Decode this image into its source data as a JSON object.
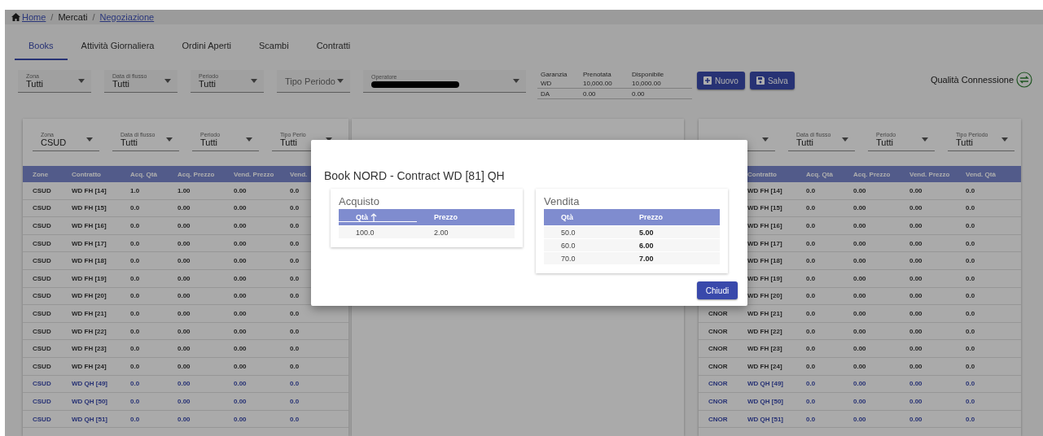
{
  "breadcrumb": {
    "separator": "/",
    "items": [
      {
        "label": "Home",
        "link": true
      },
      {
        "label": "Mercati",
        "link": false
      },
      {
        "label": "Negoziazione",
        "link": true
      }
    ]
  },
  "tabs": [
    {
      "label": "Books",
      "selected": true
    },
    {
      "label": "Attività Giornaliera",
      "selected": false
    },
    {
      "label": "Ordini Aperti",
      "selected": false
    },
    {
      "label": "Scambi",
      "selected": false
    },
    {
      "label": "Contratti",
      "selected": false
    }
  ],
  "filters": [
    {
      "kind": "select",
      "label": "Zona",
      "value": "Tutti"
    },
    {
      "kind": "select",
      "label": "Data di flusso",
      "value": "Tutti"
    },
    {
      "kind": "select",
      "label": "Periodo",
      "value": "Tutti"
    },
    {
      "kind": "placeholder",
      "placeholder": "Tipo Periodo"
    },
    {
      "kind": "redacted",
      "label": "Operatore"
    }
  ],
  "guarantee": {
    "columns": [
      "Garanzia",
      "Prenotata",
      "Disponibile"
    ],
    "rows": [
      [
        "WD",
        "10,000.00",
        "10,000.00"
      ],
      [
        "DA",
        "0.00",
        "0.00"
      ]
    ]
  },
  "buttons": [
    {
      "label": "Nuovo",
      "kind": "new"
    },
    {
      "label": "Salva",
      "kind": "save"
    }
  ],
  "connection": {
    "label": "Qualità Connessione"
  },
  "books": [
    {
      "filters": [
        {
          "kind": "full",
          "label": "Zona",
          "value": "CSUD"
        },
        {
          "kind": "full",
          "label": "Data di flusso",
          "value": "Tutti"
        },
        {
          "kind": "full",
          "label": "Periodo",
          "value": "Tutti"
        },
        {
          "kind": "full",
          "label": "Tipo Perio",
          "value": "Tutti"
        }
      ],
      "columns": [
        "Zone",
        "Contratto",
        "Acq. Qtà",
        "Acq. Prezzo",
        "Vend. Prezzo",
        "Vend."
      ],
      "rows": [
        {
          "highlighted": false,
          "cells": [
            "CSUD",
            "WD FH [14]",
            "1.0",
            "1.00",
            "0.00",
            "0.0"
          ]
        },
        {
          "highlighted": false,
          "cells": [
            "CSUD",
            "WD FH [15]",
            "0.0",
            "0.00",
            "0.00",
            "0.0"
          ]
        },
        {
          "highlighted": false,
          "cells": [
            "CSUD",
            "WD FH [16]",
            "0.0",
            "0.00",
            "0.00",
            "0.0"
          ]
        },
        {
          "highlighted": false,
          "cells": [
            "CSUD",
            "WD FH [17]",
            "0.0",
            "0.00",
            "0.00",
            "0.0"
          ]
        },
        {
          "highlighted": false,
          "cells": [
            "CSUD",
            "WD FH [18]",
            "0.0",
            "0.00",
            "0.00",
            "0.0"
          ]
        },
        {
          "highlighted": false,
          "cells": [
            "CSUD",
            "WD FH [19]",
            "0.0",
            "0.00",
            "0.00",
            "0.0"
          ]
        },
        {
          "highlighted": false,
          "cells": [
            "CSUD",
            "WD FH [20]",
            "0.0",
            "0.00",
            "0.00",
            "0.0"
          ]
        },
        {
          "highlighted": false,
          "cells": [
            "CSUD",
            "WD FH [21]",
            "0.0",
            "0.00",
            "0.00",
            "0.0"
          ]
        },
        {
          "highlighted": false,
          "cells": [
            "CSUD",
            "WD FH [22]",
            "0.0",
            "0.00",
            "0.00",
            "0.0"
          ]
        },
        {
          "highlighted": false,
          "cells": [
            "CSUD",
            "WD FH [23]",
            "0.0",
            "0.00",
            "0.00",
            "0.0"
          ]
        },
        {
          "highlighted": false,
          "cells": [
            "CSUD",
            "WD FH [24]",
            "0.0",
            "0.00",
            "0.00",
            "0.0"
          ]
        },
        {
          "highlighted": true,
          "cells": [
            "CSUD",
            "WD QH [49]",
            "0.0",
            "0.00",
            "0.00",
            "0.0"
          ]
        },
        {
          "highlighted": true,
          "cells": [
            "CSUD",
            "WD QH [50]",
            "0.0",
            "0.00",
            "0.00",
            "0.0"
          ]
        },
        {
          "highlighted": true,
          "cells": [
            "CSUD",
            "WD QH [51]",
            "0.0",
            "0.00",
            "0.00",
            "0.0"
          ]
        }
      ]
    },
    {
      "filters": [
        {
          "kind": "bare"
        },
        {
          "kind": "full",
          "label": "Data di flusso",
          "value": "Tutti"
        },
        {
          "kind": "full",
          "label": "Periodo",
          "value": "Tutti"
        },
        {
          "kind": "full",
          "label": "Tipo Periodo",
          "value": "Tutti"
        }
      ],
      "columns": [
        null,
        "Contratto",
        "Acq. Qtà",
        "Acq. Prezzo",
        "Vend. Prezzo",
        "Vend. Qtà"
      ],
      "rows": [
        {
          "highlighted": false,
          "cells": [
            null,
            "WD FH [14]",
            "0.0",
            "0.00",
            "0.00",
            "0.0"
          ]
        },
        {
          "highlighted": false,
          "cells": [
            null,
            "WD FH [15]",
            "0.0",
            "0.00",
            "0.00",
            "0.0"
          ]
        },
        {
          "highlighted": false,
          "cells": [
            null,
            "WD FH [16]",
            "0.0",
            "0.00",
            "0.00",
            "0.0"
          ]
        },
        {
          "highlighted": false,
          "cells": [
            null,
            "WD FH [17]",
            "0.0",
            "0.00",
            "0.00",
            "0.0"
          ]
        },
        {
          "highlighted": false,
          "cells": [
            null,
            "WD FH [18]",
            "0.0",
            "0.00",
            "0.00",
            "0.0"
          ]
        },
        {
          "highlighted": false,
          "cells": [
            null,
            "WD FH [19]",
            "0.0",
            "0.00",
            "0.00",
            "0.0"
          ]
        },
        {
          "highlighted": false,
          "cells": [
            null,
            "WD FH [20]",
            "0.0",
            "0.00",
            "0.00",
            "0.0"
          ]
        },
        {
          "highlighted": false,
          "cells": [
            "CNOR",
            "WD FH [21]",
            "0.0",
            "0.00",
            "0.00",
            "0.0"
          ]
        },
        {
          "highlighted": false,
          "cells": [
            "CNOR",
            "WD FH [22]",
            "0.0",
            "0.00",
            "0.00",
            "0.0"
          ]
        },
        {
          "highlighted": false,
          "cells": [
            "CNOR",
            "WD FH [23]",
            "0.0",
            "0.00",
            "0.00",
            "0.0"
          ]
        },
        {
          "highlighted": false,
          "cells": [
            "CNOR",
            "WD FH [24]",
            "0.0",
            "0.00",
            "0.00",
            "0.0"
          ]
        },
        {
          "highlighted": true,
          "cells": [
            "CNOR",
            "WD QH [49]",
            "0.0",
            "0.00",
            "0.00",
            "0.0"
          ]
        },
        {
          "highlighted": true,
          "cells": [
            "CNOR",
            "WD QH [50]",
            "0.0",
            "0.00",
            "0.00",
            "0.0"
          ]
        },
        {
          "highlighted": true,
          "cells": [
            "CNOR",
            "WD QH [51]",
            "0.0",
            "0.00",
            "0.00",
            "0.0"
          ]
        }
      ]
    }
  ],
  "dialog": {
    "title": "Book NORD - Contract WD [81] QH",
    "tables": [
      {
        "title": "Acquisto",
        "columns": [
          {
            "label": "Qtà",
            "sorted": true,
            "strong": false
          },
          {
            "label": "Prezzo",
            "sorted": false,
            "strong": false
          }
        ],
        "rows": [
          [
            "100.0",
            "2.00"
          ]
        ]
      },
      {
        "title": "Vendita",
        "columns": [
          {
            "label": "Qtà",
            "sorted": false,
            "strong": false
          },
          {
            "label": "Prezzo",
            "sorted": false,
            "strong": true
          }
        ],
        "rows": [
          [
            "50.0",
            "5.00"
          ],
          [
            "60.0",
            "6.00"
          ],
          [
            "70.0",
            "7.00"
          ]
        ]
      }
    ],
    "close_button": "Chiudi"
  }
}
